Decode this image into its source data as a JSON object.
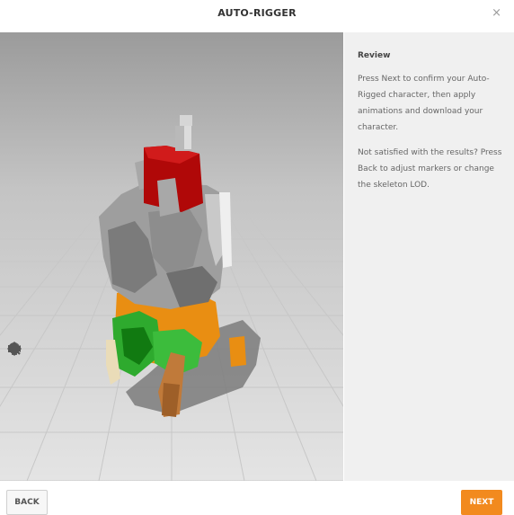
{
  "window": {
    "title": "AUTO-RIGGER",
    "close_glyph": "×"
  },
  "panel": {
    "heading": "Review",
    "paragraph_1": "Press Next to confirm your Auto-Rigged character, then apply animations and download your character.",
    "paragraph_2": "Not satisfied with the results? Press Back to adjust markers or change the skeleton LOD."
  },
  "toolbar": {
    "tools": [
      "skull-icon",
      "rotate-icon",
      "move-icon",
      "zoom-icon",
      "power-icon",
      "camera-icon"
    ]
  },
  "footer": {
    "back_label": "BACK",
    "next_label": "NEXT"
  },
  "colors": {
    "accent": "#f28a1e",
    "viewport_bg": "#d7d7d7",
    "panel_bg": "#f0f0f0"
  }
}
